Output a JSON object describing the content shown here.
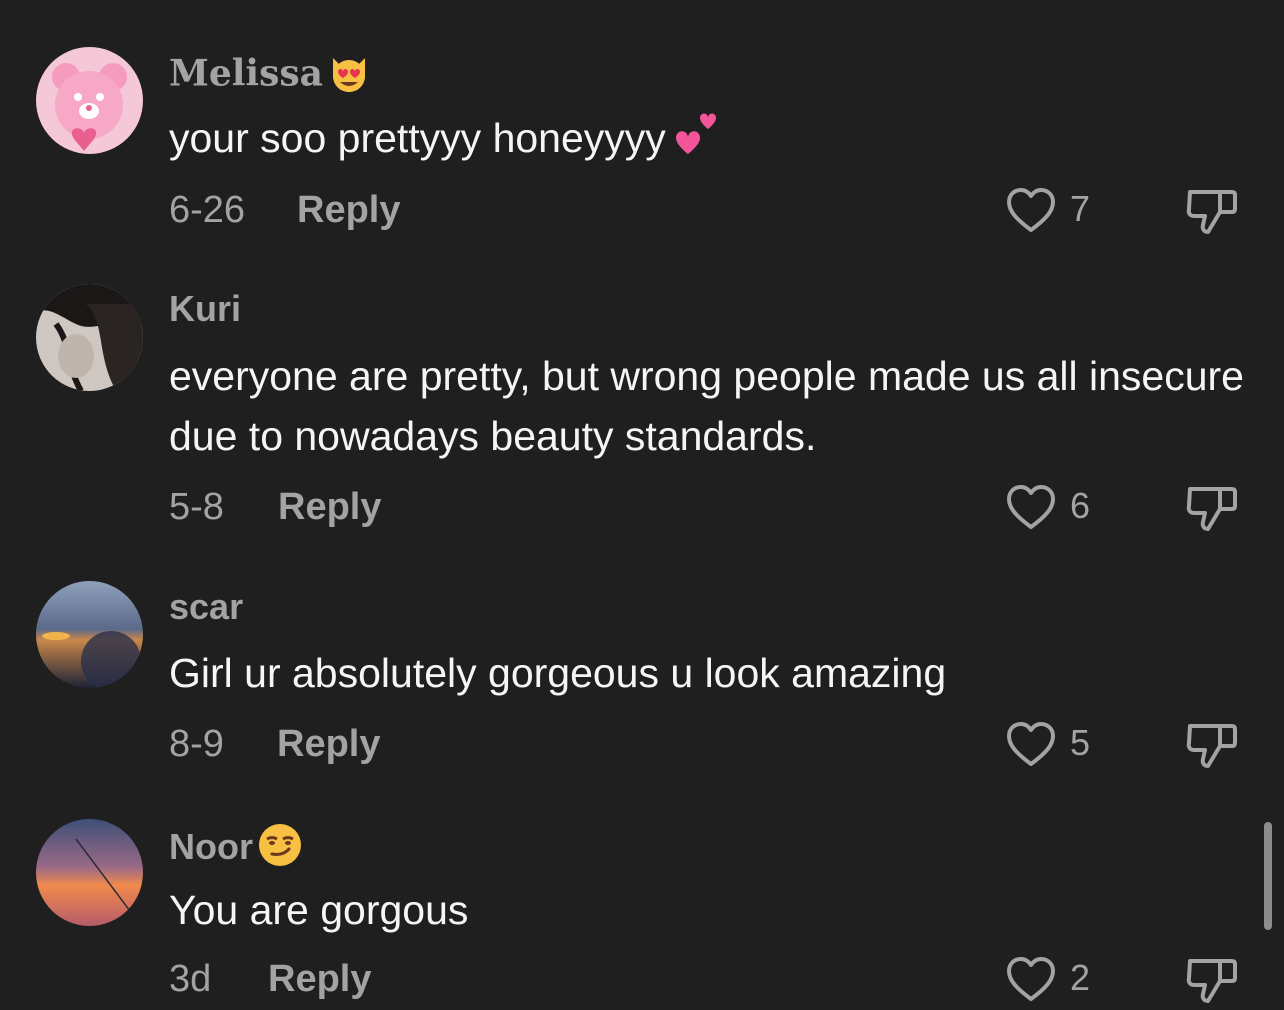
{
  "comments": [
    {
      "username": "Melissa",
      "username_emoji": "smiling-cat-heart-eyes-emoji",
      "text": "your soo prettyyy honeyyyy",
      "text_emoji": "two-hearts-emoji",
      "date": "6-26",
      "reply_label": "Reply",
      "likes": "7"
    },
    {
      "username": "Kuri",
      "text": "everyone are pretty, but wrong people made us all insecure due to nowadays beauty standards.",
      "date": "5-8",
      "reply_label": "Reply",
      "likes": "6"
    },
    {
      "username": "scar",
      "text": "Girl ur absolutely gorgeous u look amazing",
      "date": "8-9",
      "reply_label": "Reply",
      "likes": "5"
    },
    {
      "username": "Noor",
      "username_emoji": "smirking-face-emoji",
      "text": "You are gorgous",
      "date": "3d",
      "reply_label": "Reply",
      "likes": "2"
    }
  ],
  "colors": {
    "background": "#1f1f1f",
    "primary_text": "#f5f5f5",
    "secondary_text": "#a3a3a3",
    "scrollbar": "#8c8c8c"
  },
  "icons": [
    "heart-outline-icon",
    "thumbs-down-icon"
  ]
}
